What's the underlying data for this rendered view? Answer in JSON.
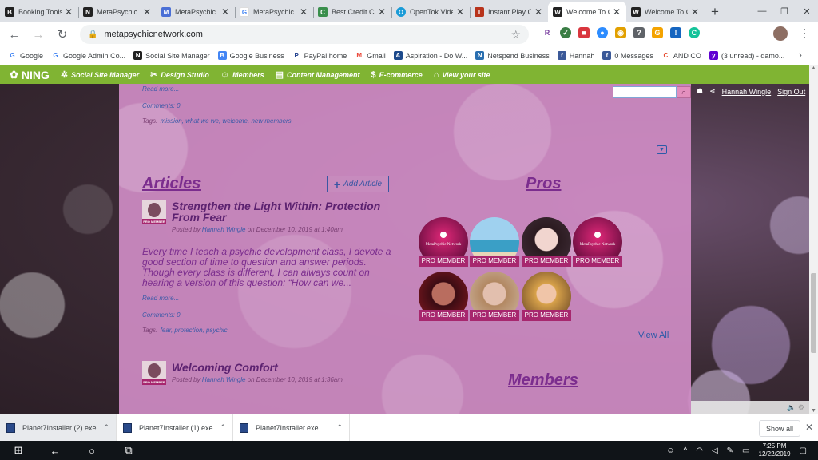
{
  "browser": {
    "tabs": [
      {
        "title": "Booking Tools",
        "color": "#222222",
        "glyph": "B"
      },
      {
        "title": "MetaPsychic N",
        "color": "#222222",
        "glyph": "N"
      },
      {
        "title": "MetaPsychic N",
        "color": "#4a6fd6",
        "glyph": "M"
      },
      {
        "title": "MetaPsychic N",
        "color": "#ffffff",
        "glyph": "G"
      },
      {
        "title": "Best Credit Ca",
        "color": "#3a8f4c",
        "glyph": "C"
      },
      {
        "title": "OpenTok Vide",
        "color": "#1a9bd7",
        "glyph": "O"
      },
      {
        "title": "Instant Play C",
        "color": "#b8331b",
        "glyph": "I"
      },
      {
        "title": "Welcome To C",
        "color": "#222222",
        "glyph": "W"
      },
      {
        "title": "Welcome To C",
        "color": "#222222",
        "glyph": "W"
      }
    ],
    "active_tab": 7,
    "new_tab_label": "+",
    "url": "metapsychicnetwork.com",
    "extensions": [
      {
        "glyph": "R",
        "color": "#7a3fa0"
      },
      {
        "glyph": "✓",
        "color": "#3a7d44"
      },
      {
        "glyph": "■",
        "color": "#d9363e"
      },
      {
        "glyph": "●",
        "color": "#2d8cff"
      },
      {
        "glyph": "◉",
        "color": "#e2a000"
      },
      {
        "glyph": "?",
        "color": "#5f6368"
      },
      {
        "glyph": "G",
        "color": "#f4a300"
      },
      {
        "glyph": "!",
        "color": "#1565c0"
      },
      {
        "glyph": "C",
        "color": "#15c39a"
      }
    ]
  },
  "bookmarks": [
    {
      "label": "Google",
      "color": "#4285f4",
      "glyph": "G"
    },
    {
      "label": "Google Admin Co...",
      "color": "#4285f4",
      "glyph": "G"
    },
    {
      "label": "Social Site Manager",
      "color": "#222222",
      "glyph": "N"
    },
    {
      "label": "Google Business",
      "color": "#4285f4",
      "glyph": "B"
    },
    {
      "label": "PayPal home",
      "color": "#1b3b8b",
      "glyph": "P"
    },
    {
      "label": "Gmail",
      "color": "#ea4335",
      "glyph": "M"
    },
    {
      "label": "Aspiration - Do W...",
      "color": "#1d4a8c",
      "glyph": "A"
    },
    {
      "label": "Netspend Business",
      "color": "#2a6fb0",
      "glyph": "N"
    },
    {
      "label": "Hannah",
      "color": "#3b5998",
      "glyph": "f"
    },
    {
      "label": "0 Messages",
      "color": "#3b5998",
      "glyph": "f"
    },
    {
      "label": "AND CO",
      "color": "#e64a2e",
      "glyph": "C"
    },
    {
      "label": "(3 unread) - damo...",
      "color": "#6001d2",
      "glyph": "y"
    }
  ],
  "ning": {
    "logo": "NING",
    "menu": [
      {
        "label": "Social Site Manager",
        "icon": "✲"
      },
      {
        "label": "Design Studio",
        "icon": "✂"
      },
      {
        "label": "Members",
        "icon": "👥"
      },
      {
        "label": "Content Management",
        "icon": "☰"
      },
      {
        "label": "E-commerce",
        "icon": "$"
      },
      {
        "label": "View your site",
        "icon": "⌂"
      }
    ]
  },
  "site": {
    "user_name": "Hannah Wingle",
    "sign_out": "Sign Out",
    "prev_post": {
      "read_more": "Read more...",
      "comments": "Comments: 0",
      "tags_label": "Tags:",
      "tags": "mission, what we we, welcome, new members"
    },
    "articles": {
      "heading": "Articles",
      "add_label": "Add Article",
      "items": [
        {
          "title_line1": "Strengthen the Light Within: Protection",
          "title_line2": "From Fear",
          "posted_by_prefix": "Posted by",
          "author": "Hannah Wingle",
          "date": "on December 10, 2019 at 1:40am",
          "excerpt": "Every time I teach a psychic development class, I devote a good section of time to question and answer periods. Though every class is different, I can always count on hearing a version of this question: “How can we...",
          "read_more": "Read more...",
          "comments": "Comments: 0",
          "tags_label": "Tags:",
          "tags": "fear, protection, psychic"
        },
        {
          "title_line1": "Welcoming Comfort",
          "posted_by_prefix": "Posted by",
          "author": "Hannah Wingle",
          "date": "on December 10, 2019 at 1:36am"
        }
      ]
    },
    "pros": {
      "heading": "Pros",
      "badge": "PRO MEMBER",
      "logo_text": "MetaPsychic Network",
      "view_all": "View All"
    },
    "members": {
      "heading": "Members"
    },
    "avatar_tag": "PRO MEMBER"
  },
  "downloads": {
    "items": [
      "Planet7Installer (2).exe",
      "Planet7Installer (1).exe",
      "Planet7Installer.exe"
    ],
    "show_all": "Show all"
  },
  "taskbar": {
    "time": "7:25 PM",
    "date": "12/22/2019"
  }
}
